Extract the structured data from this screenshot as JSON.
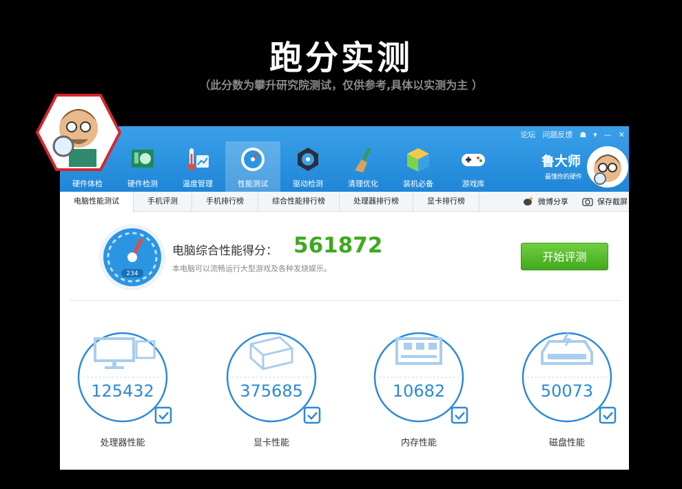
{
  "banner": {
    "title": "跑分实测",
    "subtitle": "（此分数为攀升研究院测试，仅供参考,具体以实测为主 ）"
  },
  "window": {
    "controls": [
      "论坛",
      "问题反馈",
      "☗",
      "▾",
      "—",
      "✕"
    ],
    "tabs": [
      {
        "label": "硬件体检",
        "icon": "health-check-icon"
      },
      {
        "label": "硬件检测",
        "icon": "circuit-board-icon"
      },
      {
        "label": "温度管理",
        "icon": "thermometer-icon"
      },
      {
        "label": "性能测试",
        "icon": "speedometer-icon",
        "active": true
      },
      {
        "label": "驱动检测",
        "icon": "gear-driver-icon"
      },
      {
        "label": "清理优化",
        "icon": "broom-icon"
      },
      {
        "label": "装机必备",
        "icon": "cube-box-icon"
      },
      {
        "label": "游戏库",
        "icon": "gamepad-icon"
      }
    ],
    "brand": {
      "name": "鲁大师",
      "slogan": "最懂你的硬件"
    },
    "subnav": [
      {
        "label": "电脑性能测试",
        "active": true
      },
      {
        "label": "手机评测"
      },
      {
        "label": "手机排行榜"
      },
      {
        "label": "综合性能排行榜"
      },
      {
        "label": "处理器排行榜"
      },
      {
        "label": "显卡排行榜"
      }
    ],
    "share": {
      "weibo": "微博分享",
      "screenshot": "保存截屏"
    }
  },
  "score": {
    "label": "电脑综合性能得分：",
    "value": "561872",
    "desc": "本电脑可以流畅运行大型游戏及各种发烧娱乐。",
    "gauge_readout": "234",
    "start_button": "开始评测"
  },
  "metrics": [
    {
      "label": "处理器性能",
      "value": "125432",
      "icon": "cpu-monitor-icon"
    },
    {
      "label": "显卡性能",
      "value": "375685",
      "icon": "gpu-cube-icon"
    },
    {
      "label": "内存性能",
      "value": "10682",
      "icon": "memory-chip-icon"
    },
    {
      "label": "磁盘性能",
      "value": "50073",
      "icon": "hard-disk-icon"
    }
  ],
  "colors": {
    "topbar": "#2b95e2",
    "score_green": "#3caa1e",
    "metric_blue": "#2a89d8",
    "button_green": "#4cb825"
  }
}
